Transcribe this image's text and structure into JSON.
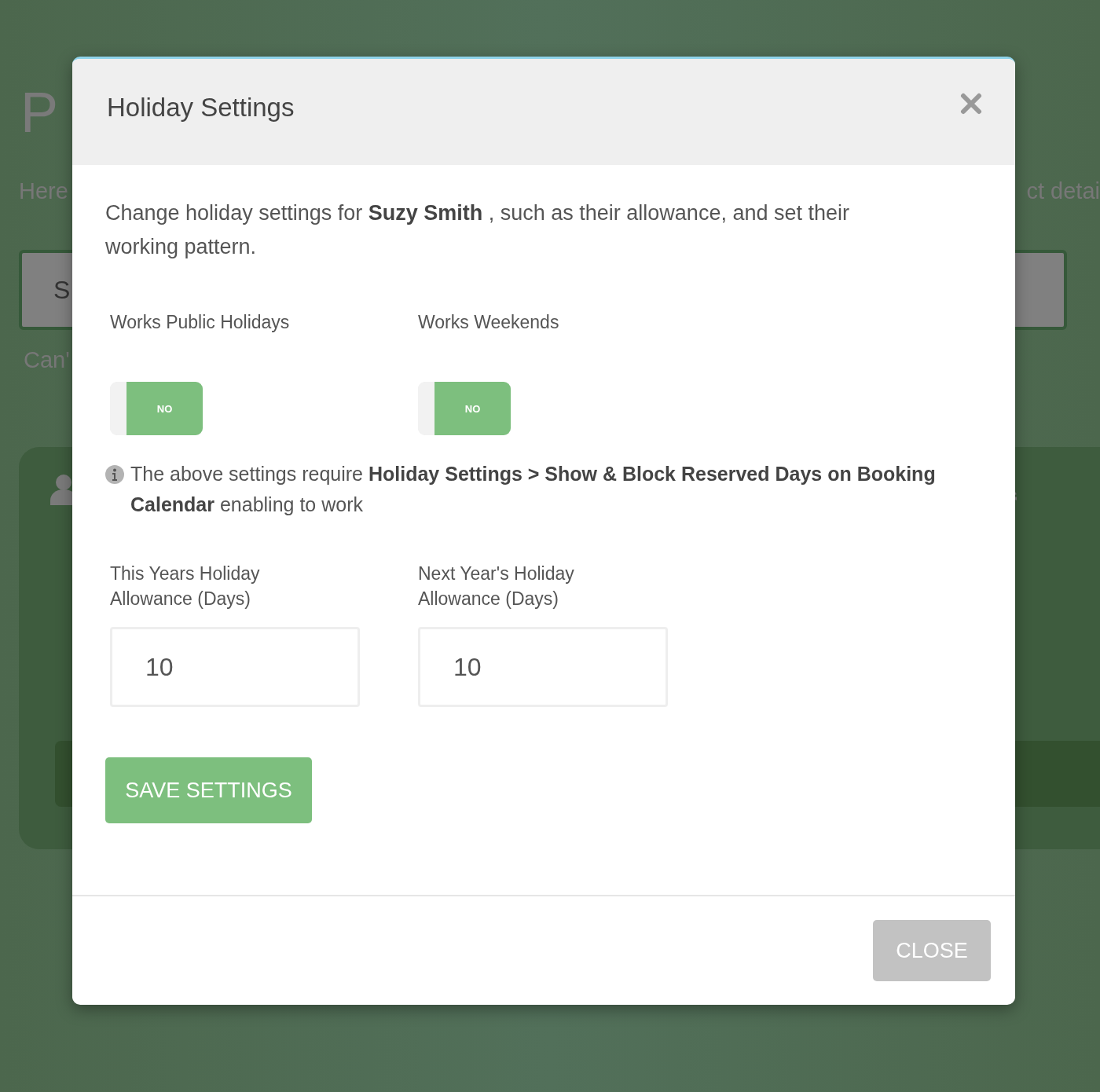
{
  "background": {
    "heading": "P",
    "intro_left": "Here",
    "intro_right": "ct detai",
    "search": {
      "value": "S"
    },
    "hint": "Can'"
  },
  "dialog": {
    "title": "Holiday Settings",
    "description": "Change holiday settings for **Suzy Smith** , such as their allowance, and set their working pattern.",
    "toggles": [
      {
        "label": "Works Public Holidays",
        "text": "NO",
        "on": false
      },
      {
        "label": "Works Weekends",
        "text": "NO",
        "on": false
      }
    ],
    "note": "The above settings require **Holiday Settings > Show & Block Reserved Days on Booking Calendar** enabling to work",
    "allowances": [
      {
        "label": "This Years Holiday Allowance (Days)",
        "value": "10"
      },
      {
        "label": "Next Year's Holiday Allowance (Days)",
        "value": "10"
      }
    ],
    "save_button": "SAVE SETTINGS",
    "close_button": "CLOSE"
  }
}
